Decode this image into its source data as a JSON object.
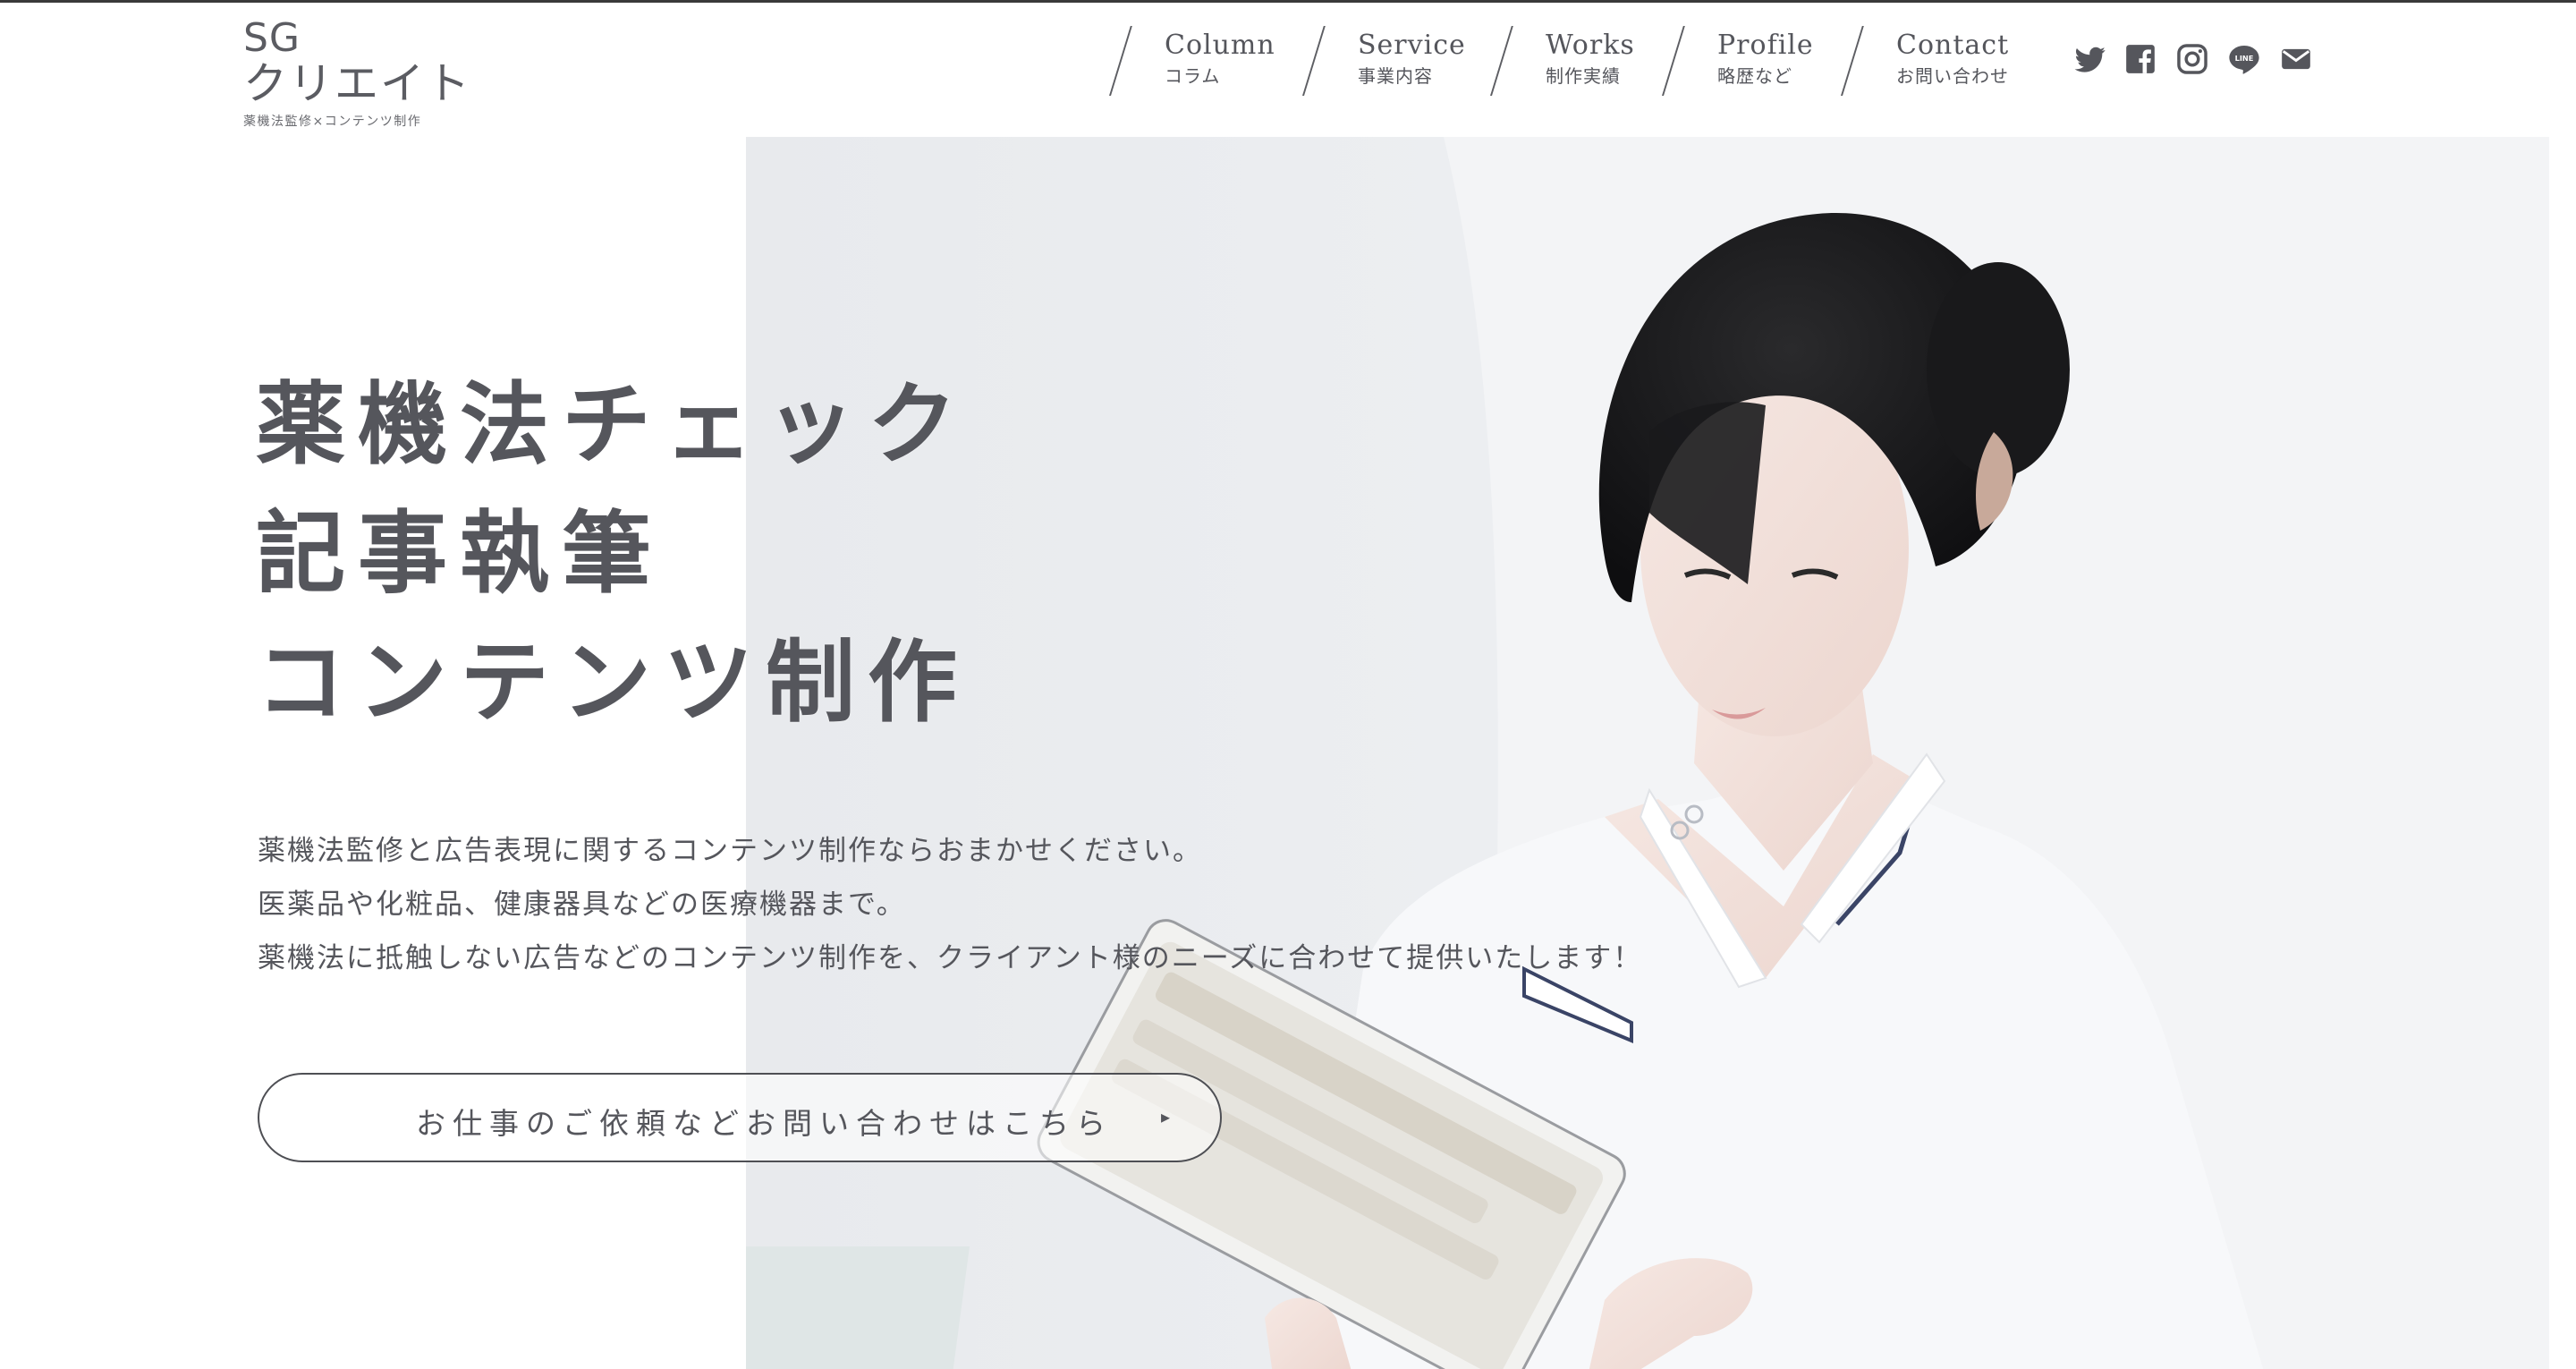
{
  "logo": {
    "line1": "SG",
    "line2": "クリエイト",
    "tagline": "薬機法監修×コンテンツ制作"
  },
  "nav": [
    {
      "en": "Column",
      "ja": "コラム"
    },
    {
      "en": "Service",
      "ja": "事業内容"
    },
    {
      "en": "Works",
      "ja": "制作実績"
    },
    {
      "en": "Profile",
      "ja": "略歴など"
    },
    {
      "en": "Contact",
      "ja": "お問い合わせ"
    }
  ],
  "social": [
    "twitter-icon",
    "facebook-icon",
    "instagram-icon",
    "line-icon",
    "mail-icon"
  ],
  "hero": {
    "title_lines": [
      "薬機法チェック",
      "記事執筆",
      "コンテンツ制作"
    ],
    "description": [
      "薬機法監修と広告表現に関するコンテンツ制作ならおまかせください。",
      "医薬品や化粧品、健康器具などの医療機器まで。",
      "薬機法に抵触しない広告などのコンテンツ制作を、クライアント様のニーズに合わせて提供いたします！"
    ],
    "cta_label": "お仕事のご依頼などお問い合わせはこちら",
    "cta_arrow": "▸"
  },
  "colors": {
    "text": "#55565c",
    "background": "#ffffff",
    "photo_backdrop": "#eceef1"
  }
}
